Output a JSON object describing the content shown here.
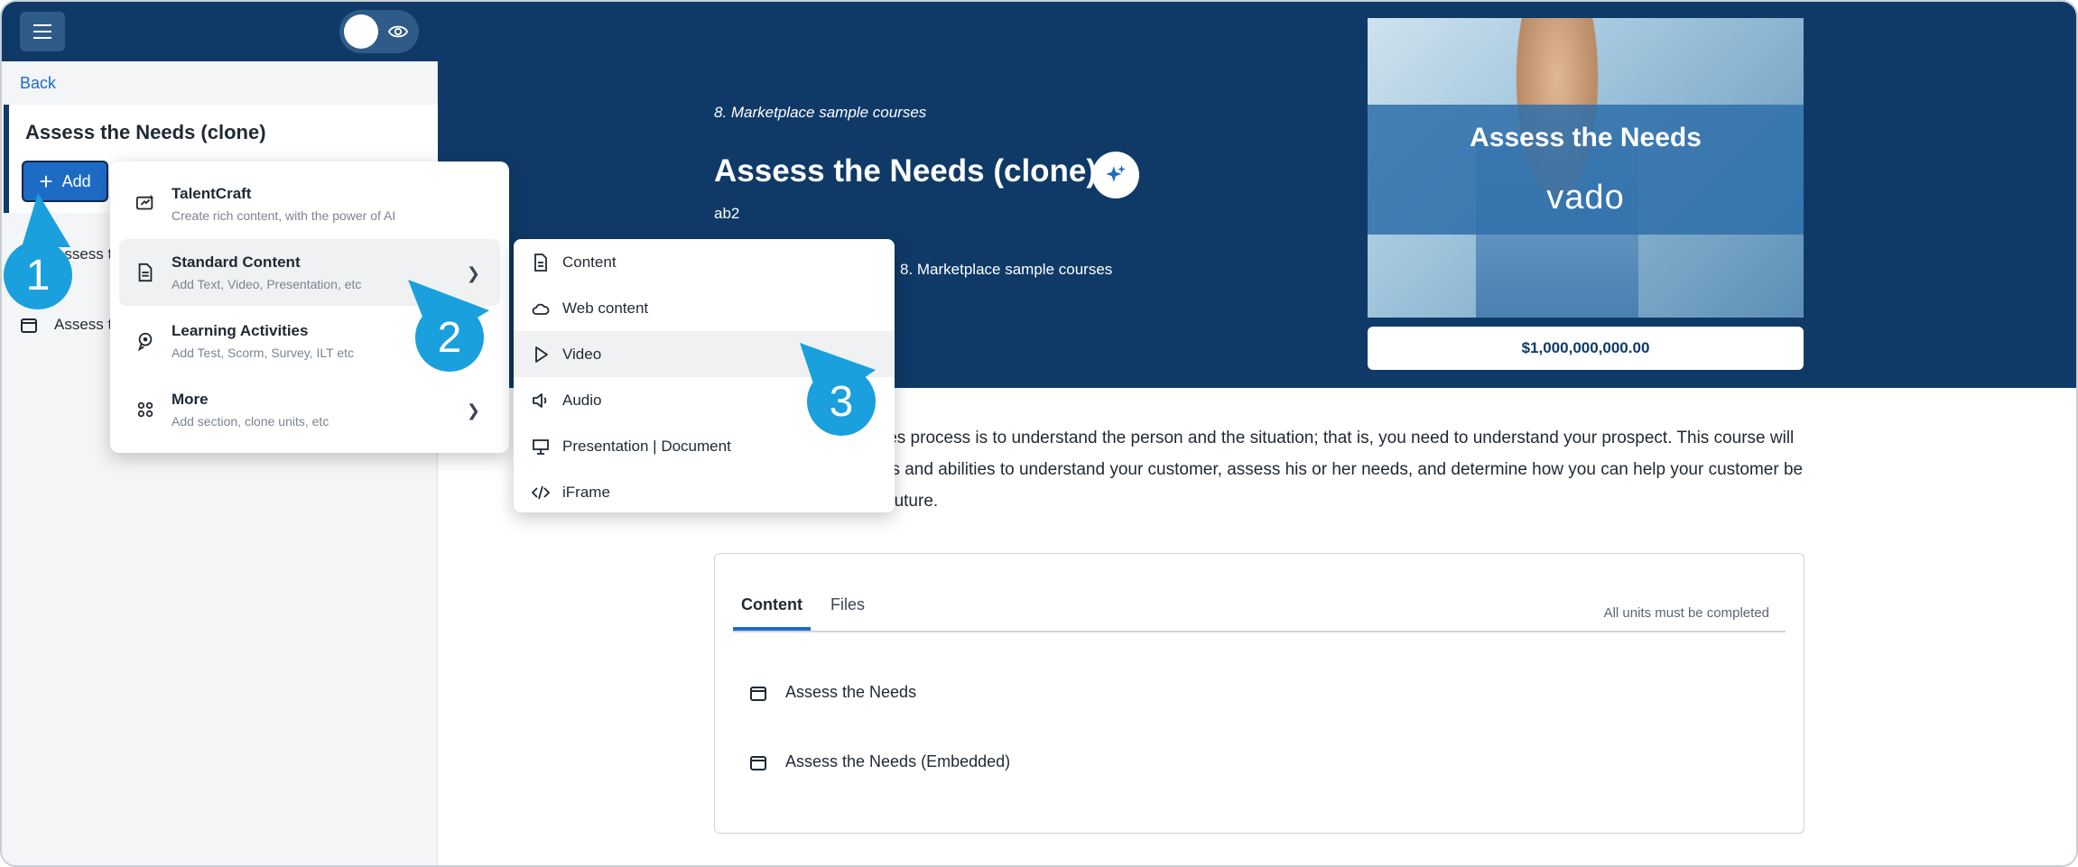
{
  "sidebar": {
    "back": "Back",
    "course_title": "Assess the Needs (clone)",
    "add_label": "Add",
    "items": [
      {
        "label": "Assess the Needs"
      },
      {
        "label": "Assess the Needs (Embedded)"
      }
    ]
  },
  "hero": {
    "breadcrumb": "8. Marketplace sample courses",
    "title": "Assess the Needs (clone)",
    "code": "ab2",
    "category": "8. Marketplace sample courses",
    "thumbnail_title": "Assess the Needs",
    "thumbnail_logo": "vado",
    "price": "$1,000,000,000.00"
  },
  "description": "The first step of the sales process is to understand the person and the situation; that is, you need to understand your prospect. This course will help you build your skills and abilities to understand your customer, assess his or her needs, and determine how you can help your customer be more successful in the future.",
  "content_card": {
    "tabs": [
      {
        "label": "Content"
      },
      {
        "label": "Files"
      }
    ],
    "note": "All units must be completed",
    "units": [
      {
        "label": "Assess the Needs"
      },
      {
        "label": "Assess the Needs (Embedded)"
      }
    ]
  },
  "add_menu": {
    "items": [
      {
        "title": "TalentCraft",
        "subtitle": "Create rich content, with the power of AI",
        "icon": "ai-craft-icon"
      },
      {
        "title": "Standard Content",
        "subtitle": "Add Text, Video, Presentation, etc",
        "icon": "document-icon"
      },
      {
        "title": "Learning Activities",
        "subtitle": "Add Test, Scorm, Survey, ILT etc",
        "icon": "activity-icon"
      },
      {
        "title": "More",
        "subtitle": "Add section, clone units, etc",
        "icon": "grid-icon"
      }
    ]
  },
  "submenu": {
    "items": [
      {
        "label": "Content",
        "icon": "file-icon"
      },
      {
        "label": "Web content",
        "icon": "cloud-icon"
      },
      {
        "label": "Video",
        "icon": "play-icon"
      },
      {
        "label": "Audio",
        "icon": "speaker-icon"
      },
      {
        "label": "Presentation | Document",
        "icon": "presentation-icon"
      },
      {
        "label": "iFrame",
        "icon": "code-icon"
      }
    ]
  },
  "callouts": [
    "1",
    "2",
    "3"
  ],
  "colors": {
    "brand_navy": "#0f3a68",
    "accent_blue": "#1e6bc6",
    "callout": "#1aa0dc"
  }
}
